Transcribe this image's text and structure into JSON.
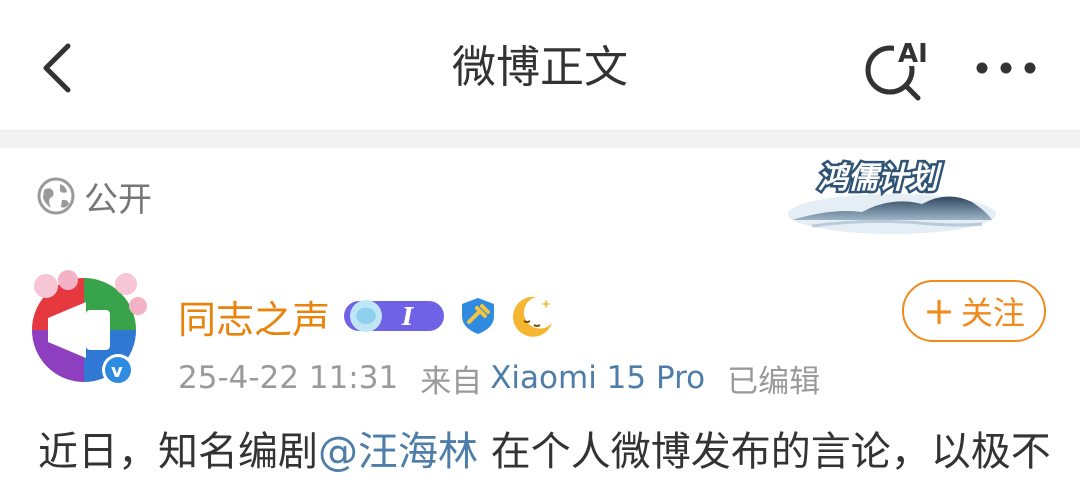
{
  "header": {
    "title": "微博正文",
    "ai_badge": "AI",
    "back_icon": "chevron-left-icon",
    "ai_search_icon": "ai-search-icon",
    "more_icon": "more-dots-icon"
  },
  "post": {
    "visibility": "公开",
    "banner_text": "鸿儒计划",
    "author": {
      "name": "同志之声",
      "badge_letter": "I",
      "verified_mark": "v"
    },
    "timestamp": "25-4-22 11:31",
    "source_prefix": "来自",
    "device": "Xiaomi 15 Pro",
    "edited": "已编辑",
    "follow_label": "关注",
    "follow_plus": "+",
    "text_before": "近日，知名编剧",
    "mention": "@汪海林",
    "text_after": " 在个人微博发布的言论，以极不"
  },
  "colors": {
    "author": "#e8830c",
    "link": "#4d7da8",
    "follow": "#f08a1d",
    "meta": "#9a9a9a"
  }
}
